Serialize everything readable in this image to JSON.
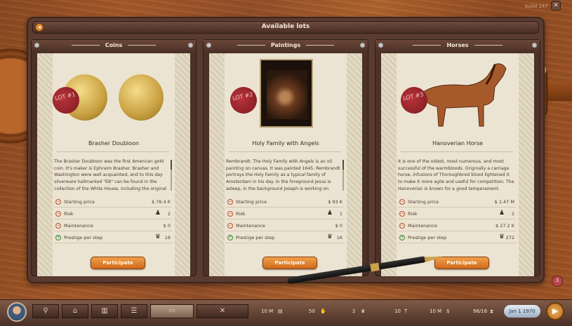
{
  "build_label": "build 147",
  "panel_title": "Available lots",
  "lots": [
    {
      "category": "Coins",
      "lot_label": "LOT #1",
      "name": "Brasher Doubloon",
      "description": "The Brasher Doubloon was the first American gold coin. It's maker is Ephraim Brasher. Brasher and Washington were well acquainted, and to this day silverware hallmarked \"EB\" can be found in the collection of the White House, including the original",
      "starting_price_label": "Starting price",
      "starting_price": "$ 76.4 K",
      "risk_label": "Risk",
      "risk": "2",
      "maintenance_label": "Maintenance",
      "maintenance": "$ 0",
      "prestige_label": "Prestige per step",
      "prestige": "16",
      "participate_label": "Participate"
    },
    {
      "category": "Paintings",
      "lot_label": "LOT #2",
      "name": "Holy Family with Angels",
      "description": "Rembrandt. The Holy Family with Angels is an oil painting on canvas. It was painted 1645. Rembrandt portrays the Holy Family as a typical family of Amsterdam in his day. In the foreground Jesus is asleep, in the background Joseph is working on",
      "starting_price_label": "Starting price",
      "starting_price": "$ 93 K",
      "risk_label": "Risk",
      "risk": "1",
      "maintenance_label": "Maintenance",
      "maintenance": "$ 0",
      "prestige_label": "Prestige per step",
      "prestige": "16",
      "participate_label": "Participate"
    },
    {
      "category": "Horses",
      "lot_label": "LOT #3",
      "name": "Hanoverian Horse",
      "description": "It is one of the oldest, most numerous, and most successful of the warmbloods. Originally a carriage horse, infusions of Thoroughbred blood lightened it to make it more agile and useful for competition. The Hanoverian is known for a good temperament.",
      "starting_price_label": "Starting price",
      "starting_price": "$ 1.47 M",
      "risk_label": "Risk",
      "risk": "2",
      "maintenance_label": "Maintenance",
      "maintenance": "$ 27.2 K",
      "prestige_label": "Prestige per step",
      "prestige": "272",
      "participate_label": "Participate"
    }
  ],
  "notification_count": "3",
  "bottom_stats": {
    "money": "10 M",
    "cards": "50",
    "crowns": "2",
    "t_stat": "10",
    "money2": "10 M",
    "ratio": "98/16",
    "date": "Jan 1 1970"
  },
  "icons": [
    "back-arrow-icon",
    "close-icon",
    "shield-icon",
    "bank-icon",
    "chart-icon",
    "cabinet-icon",
    "bed-icon",
    "network-icon",
    "play-icon"
  ]
}
